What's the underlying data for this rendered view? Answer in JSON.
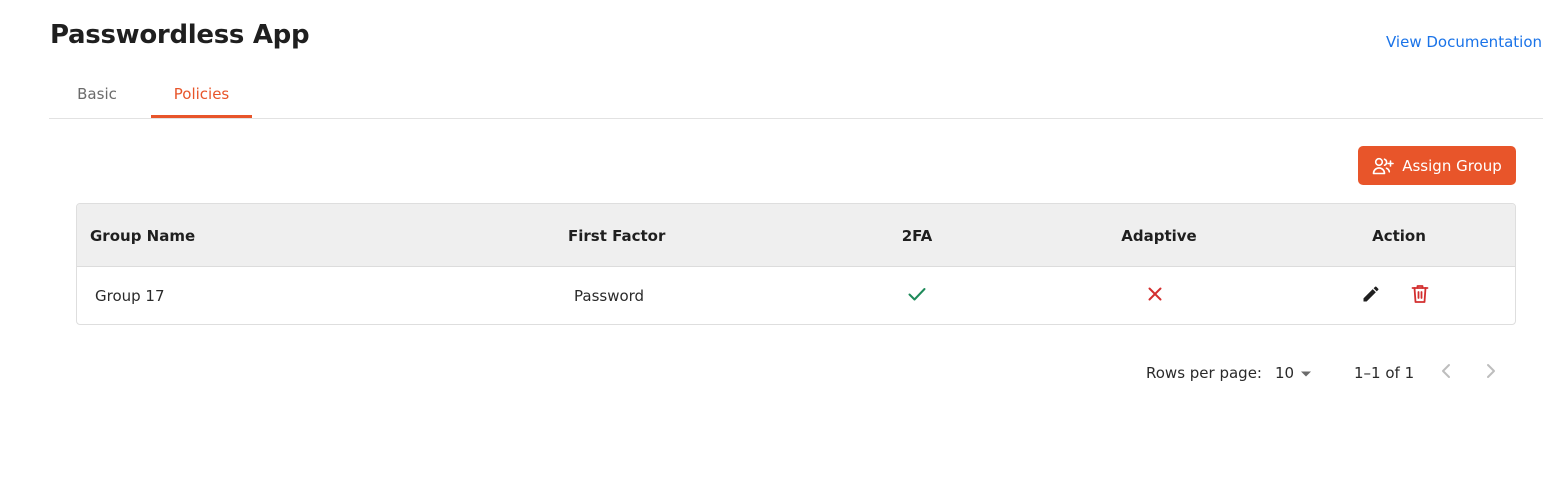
{
  "header": {
    "title": "Passwordless App",
    "doc_link": "View Documentation"
  },
  "tabs": [
    {
      "label": "Basic",
      "active": false
    },
    {
      "label": "Policies",
      "active": true
    }
  ],
  "toolbar": {
    "assign_label": "Assign Group",
    "assign_icon": "user-plus-icon"
  },
  "colors": {
    "accent": "#e8552a",
    "link": "#1a73e8",
    "success": "#1e8a5a",
    "danger": "#d32f2f"
  },
  "table": {
    "columns": [
      "Group Name",
      "First Factor",
      "2FA",
      "Adaptive",
      "Action"
    ],
    "rows": [
      {
        "group_name": "Group 17",
        "first_factor": "Password",
        "two_fa": true,
        "two_fa_icon": "check-icon",
        "adaptive": false,
        "adaptive_icon": "close-icon",
        "actions": [
          "edit-icon",
          "delete-icon"
        ]
      }
    ]
  },
  "pagination": {
    "rows_per_page_label": "Rows per page:",
    "rows_per_page": "10",
    "range": "1–1 of 1"
  }
}
